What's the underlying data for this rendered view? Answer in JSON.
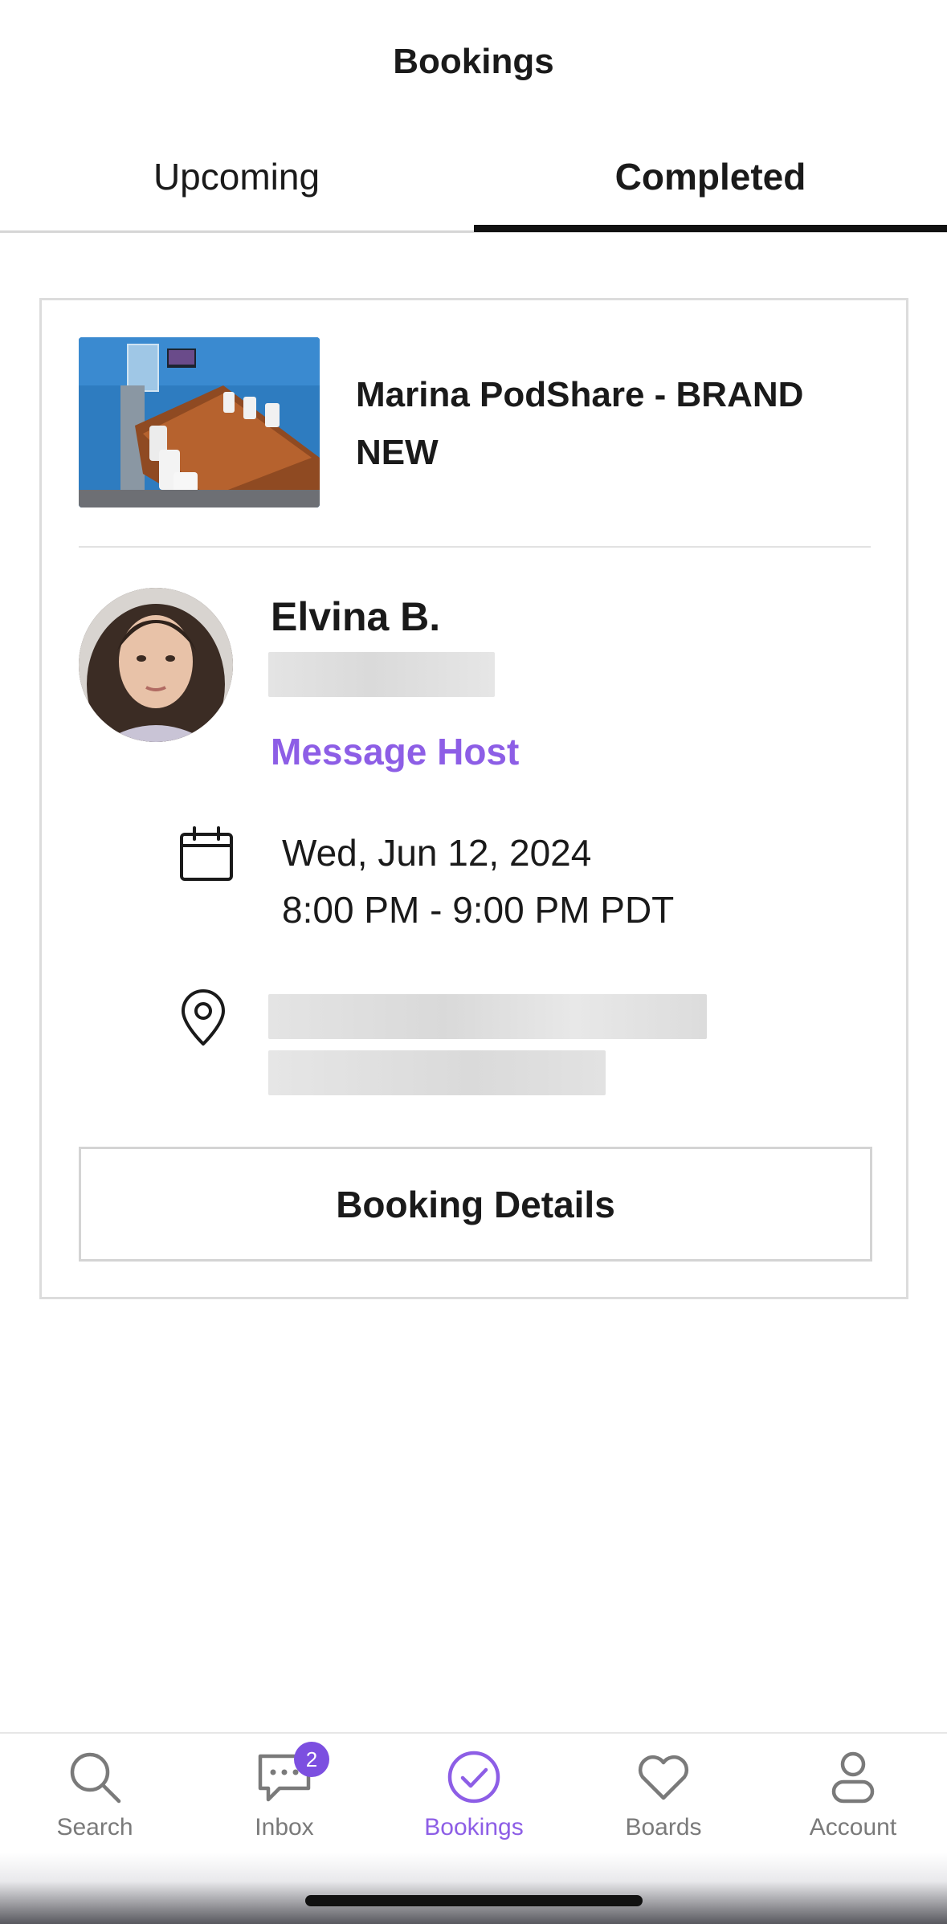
{
  "header": {
    "title": "Bookings"
  },
  "tabs": [
    {
      "label": "Upcoming",
      "active": false
    },
    {
      "label": "Completed",
      "active": true
    }
  ],
  "booking": {
    "listing_title": "Marina PodShare - BRAND NEW",
    "host_name": "Elvina B.",
    "message_host_label": "Message Host",
    "date": "Wed, Jun 12, 2024",
    "time": "8:00 PM - 9:00 PM PDT",
    "details_button": "Booking Details"
  },
  "bottom_nav": {
    "items": [
      {
        "label": "Search",
        "icon": "search-icon",
        "active": false
      },
      {
        "label": "Inbox",
        "icon": "chat-bubble-icon",
        "active": false,
        "badge": "2"
      },
      {
        "label": "Bookings",
        "icon": "check-circle-icon",
        "active": true
      },
      {
        "label": "Boards",
        "icon": "heart-icon",
        "active": false
      },
      {
        "label": "Account",
        "icon": "person-icon",
        "active": false
      }
    ]
  },
  "colors": {
    "accent": "#8d5ee6",
    "badge": "#7c4fe0",
    "text": "#1a1a1a",
    "muted": "#7a7a7a"
  }
}
